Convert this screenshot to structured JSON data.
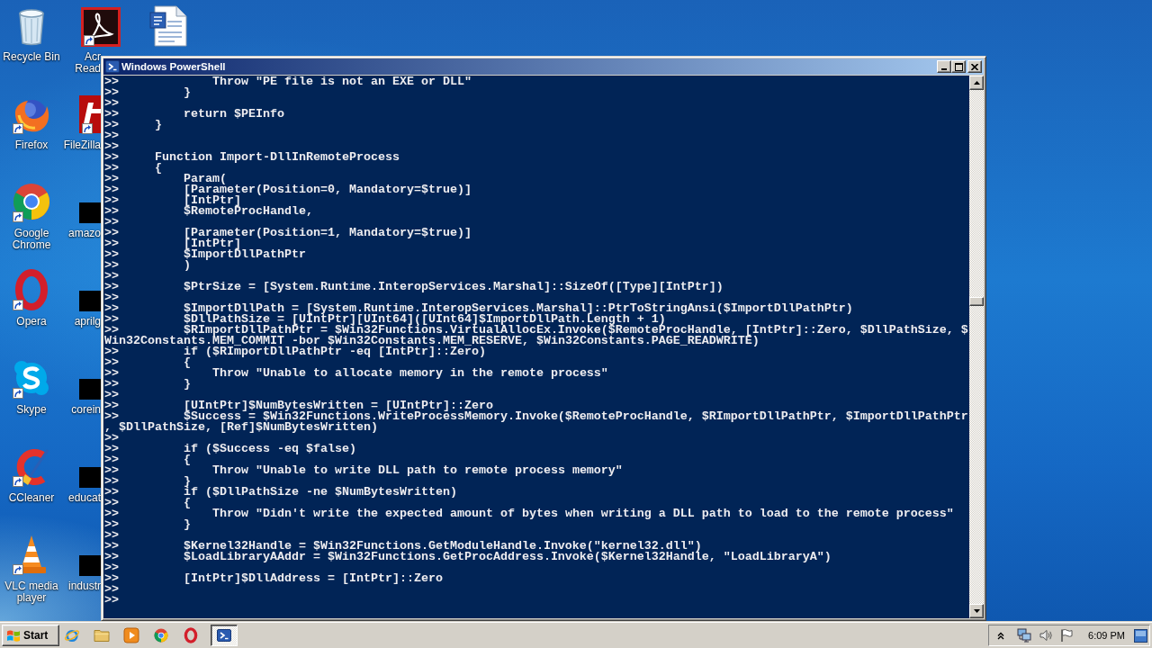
{
  "desktop": {
    "columns": [
      {
        "icons": [
          {
            "kind": "trash",
            "label_lines": [
              "Recycle Bin"
            ],
            "shortcut": false
          },
          {
            "kind": "fox",
            "label_lines": [
              "Firefox"
            ],
            "shortcut": true
          },
          {
            "kind": "wheel",
            "label_lines": [
              "Google",
              "Chrome"
            ],
            "shortcut": true
          },
          {
            "kind": "ring",
            "label_lines": [
              "Opera"
            ],
            "shortcut": true
          },
          {
            "kind": "cloud",
            "label_lines": [
              "Skype"
            ],
            "shortcut": true
          },
          {
            "kind": "brush",
            "label_lines": [
              "CCleaner"
            ],
            "shortcut": true
          },
          {
            "kind": "cone",
            "label_lines": [
              "VLC media",
              "player"
            ],
            "shortcut": true
          }
        ]
      },
      {
        "icons": [
          {
            "kind": "pdf",
            "label_lines": [
              "Acr",
              "Read"
            ],
            "shortcut": true
          },
          {
            "kind": "tile",
            "label_lines": [
              "FileZilla"
            ],
            "shortcut": true
          },
          {
            "kind": "block",
            "label_lines": [
              "amazo"
            ],
            "shortcut": false
          },
          {
            "kind": "block",
            "label_lines": [
              "aprilg"
            ],
            "shortcut": false
          },
          {
            "kind": "block",
            "label_lines": [
              "corein"
            ],
            "shortcut": false
          },
          {
            "kind": "block",
            "label_lines": [
              "educat"
            ],
            "shortcut": false
          },
          {
            "kind": "block",
            "label_lines": [
              "industr"
            ],
            "shortcut": false
          }
        ]
      },
      {
        "icons": [
          {
            "kind": "document",
            "shortcut": false
          }
        ]
      }
    ]
  },
  "window": {
    "title": "Windows PowerShell",
    "active": true,
    "lines": [
      {
        "prompt": ">>",
        "code": "            Throw \"PE file is not an EXE or DLL\""
      },
      {
        "prompt": ">>",
        "code": "        }"
      },
      {
        "prompt": ">>"
      },
      {
        "prompt": ">>",
        "code": "        return $PEInfo"
      },
      {
        "prompt": ">>",
        "code": "    }"
      },
      {
        "prompt": ">>"
      },
      {
        "prompt": ">>"
      },
      {
        "prompt": ">>",
        "code": "    Function Import-DllInRemoteProcess"
      },
      {
        "prompt": ">>",
        "code": "    {"
      },
      {
        "prompt": ">>",
        "code": "        Param("
      },
      {
        "prompt": ">>",
        "code": "        [Parameter(Position=0, Mandatory=$true)]"
      },
      {
        "prompt": ">>",
        "code": "        [IntPtr]"
      },
      {
        "prompt": ">>",
        "code": "        $RemoteProcHandle,"
      },
      {
        "prompt": ">>"
      },
      {
        "prompt": ">>",
        "code": "        [Parameter(Position=1, Mandatory=$true)]"
      },
      {
        "prompt": ">>",
        "code": "        [IntPtr]"
      },
      {
        "prompt": ">>",
        "code": "        $ImportDllPathPtr"
      },
      {
        "prompt": ">>",
        "code": "        )"
      },
      {
        "prompt": ">>"
      },
      {
        "prompt": ">>",
        "code": "        $PtrSize = [System.Runtime.InteropServices.Marshal]::SizeOf([Type][IntPtr])"
      },
      {
        "prompt": ">>"
      },
      {
        "prompt": ">>",
        "code": "        $ImportDllPath = [System.Runtime.InteropServices.Marshal]::PtrToStringAnsi($ImportDllPathPtr)"
      },
      {
        "prompt": ">>",
        "code": "        $DllPathSize = [UIntPtr][UInt64]([UInt64]$ImportDllPath.Length + 1)"
      },
      {
        "prompt": ">>",
        "code": "        $RImportDllPathPtr = $Win32Functions.VirtualAllocEx.Invoke($RemoteProcHandle, [IntPtr]::Zero, $DllPathSize, $"
      },
      {
        "code": "Win32Constants.MEM_COMMIT -bor $Win32Constants.MEM_RESERVE, $Win32Constants.PAGE_READWRITE)"
      },
      {
        "prompt": ">>",
        "code": "        if ($RImportDllPathPtr -eq [IntPtr]::Zero)"
      },
      {
        "prompt": ">>",
        "code": "        {"
      },
      {
        "prompt": ">>",
        "code": "            Throw \"Unable to allocate memory in the remote process\""
      },
      {
        "prompt": ">>",
        "code": "        }"
      },
      {
        "prompt": ">>"
      },
      {
        "prompt": ">>",
        "code": "        [UIntPtr]$NumBytesWritten = [UIntPtr]::Zero"
      },
      {
        "prompt": ">>",
        "code": "        $Success = $Win32Functions.WriteProcessMemory.Invoke($RemoteProcHandle, $RImportDllPathPtr, $ImportDllPathPtr"
      },
      {
        "code": ", $DllPathSize, [Ref]$NumBytesWritten)"
      },
      {
        "prompt": ">>"
      },
      {
        "prompt": ">>",
        "code": "        if ($Success -eq $false)"
      },
      {
        "prompt": ">>",
        "code": "        {"
      },
      {
        "prompt": ">>",
        "code": "            Throw \"Unable to write DLL path to remote process memory\""
      },
      {
        "prompt": ">>",
        "code": "        }"
      },
      {
        "prompt": ">>",
        "code": "        if ($DllPathSize -ne $NumBytesWritten)"
      },
      {
        "prompt": ">>",
        "code": "        {"
      },
      {
        "prompt": ">>",
        "code": "            Throw \"Didn't write the expected amount of bytes when writing a DLL path to load to the remote process\""
      },
      {
        "prompt": ">>",
        "code": "        }"
      },
      {
        "prompt": ">>"
      },
      {
        "prompt": ">>",
        "code": "        $Kernel32Handle = $Win32Functions.GetModuleHandle.Invoke(\"kernel32.dll\")"
      },
      {
        "prompt": ">>",
        "code": "        $LoadLibraryAAddr = $Win32Functions.GetProcAddress.Invoke($Kernel32Handle, \"LoadLibraryA\")"
      },
      {
        "prompt": ">>"
      },
      {
        "prompt": ">>",
        "code": "        [IntPtr]$DllAddress = [IntPtr]::Zero"
      },
      {
        "prompt": ">>"
      },
      {
        "prompt": ">>"
      }
    ]
  },
  "taskbar": {
    "start_label": "Start",
    "task_buttons": [
      {
        "active": true
      }
    ],
    "clock": "6:09 PM"
  }
}
